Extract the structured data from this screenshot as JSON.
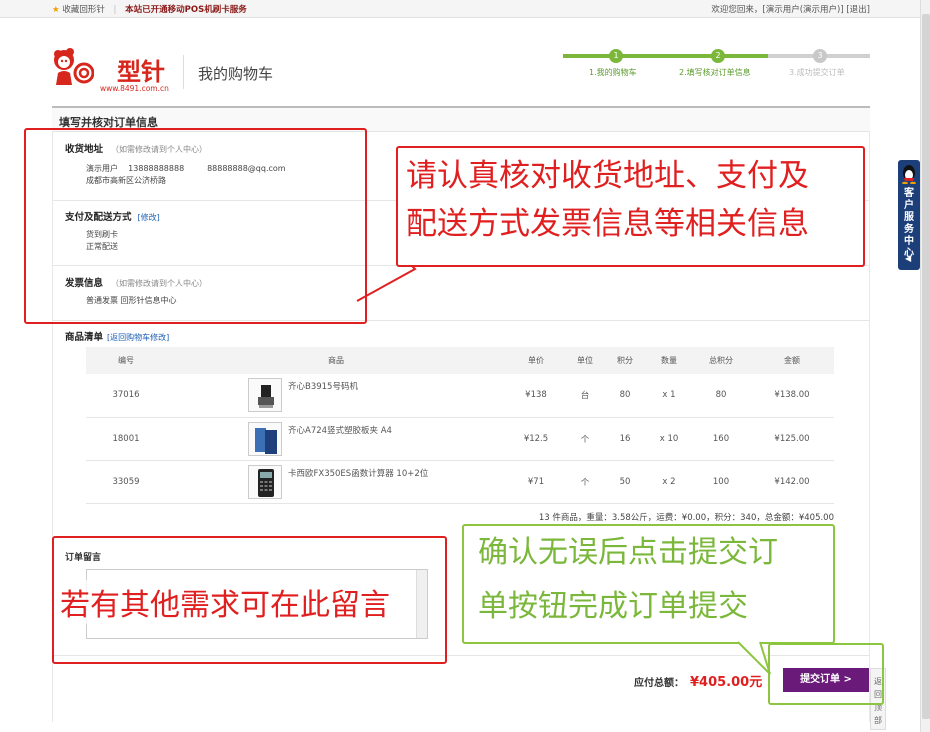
{
  "topbar": {
    "favorite": "收藏回形针",
    "promo": "本站已开通移动POS机刷卡服务",
    "welcome": "欢迎您回来，[演示用户(演示用户)] [退出]"
  },
  "logo": {
    "name": "型针",
    "url": "www.8491.com.cn"
  },
  "page_title": "我的购物车",
  "steps": [
    {
      "num": "1",
      "label": "1.我的购物车"
    },
    {
      "num": "2",
      "label": "2.填写核对订单信息"
    },
    {
      "num": "3",
      "label": "3.成功提交订单"
    }
  ],
  "section_title": "填写并核对订单信息",
  "address": {
    "title": "收货地址",
    "hint": "（如需修改请到个人中心）",
    "name": "演示用户",
    "phone": "13888888888",
    "email": "88888888@qq.com",
    "addr": "成都市高新区公济桥路"
  },
  "payment": {
    "title": "支付及配送方式",
    "edit": "[修改]",
    "pay": "货到刷卡",
    "ship": "正常配送"
  },
  "invoice": {
    "title": "发票信息",
    "hint": "（如需修改请到个人中心）",
    "content": "普通发票 回形针信息中心"
  },
  "goods": {
    "title": "商品清单",
    "back_link": "[返回购物车修改]",
    "columns": [
      "编号",
      "商品",
      "单价",
      "单位",
      "积分",
      "数量",
      "总积分",
      "金额"
    ],
    "rows": [
      {
        "id": "37016",
        "name": "齐心B3915号码机",
        "price": "¥138",
        "unit": "台",
        "points": "80",
        "qty": "x 1",
        "total_points": "80",
        "amount": "¥138.00"
      },
      {
        "id": "18001",
        "name": "齐心A724竖式塑胶板夹 A4",
        "price": "¥12.5",
        "unit": "个",
        "points": "16",
        "qty": "x 10",
        "total_points": "160",
        "amount": "¥125.00"
      },
      {
        "id": "33059",
        "name": "卡西欧FX350ES函数计算器 10+2位",
        "price": "¥71",
        "unit": "个",
        "points": "50",
        "qty": "x 2",
        "total_points": "100",
        "amount": "¥142.00"
      }
    ],
    "summary": "13 件商品，重量：3.58公斤，运费：¥0.00，积分：340，总金额：¥405.00"
  },
  "remark": {
    "title": "订单留言"
  },
  "total": {
    "label": "应付总额：",
    "amount": "¥405.00元"
  },
  "submit": "提交订单 >",
  "back_top": "返回顶部",
  "side_service": "客户服务中心",
  "annotations": {
    "check_line1": "请认真核对收货地址、支付及",
    "check_line2": "配送方式发票信息等相关信息",
    "remark_note": "若有其他需求可在此留言",
    "submit_line1": "确认无误后点击提交订",
    "submit_line2": "单按钮完成订单提交"
  },
  "colors": {
    "annotation_red": "#e02020",
    "annotation_green": "#8cc63f",
    "step_active": "#7ab73a",
    "submit_purple": "#6a1b7a"
  }
}
